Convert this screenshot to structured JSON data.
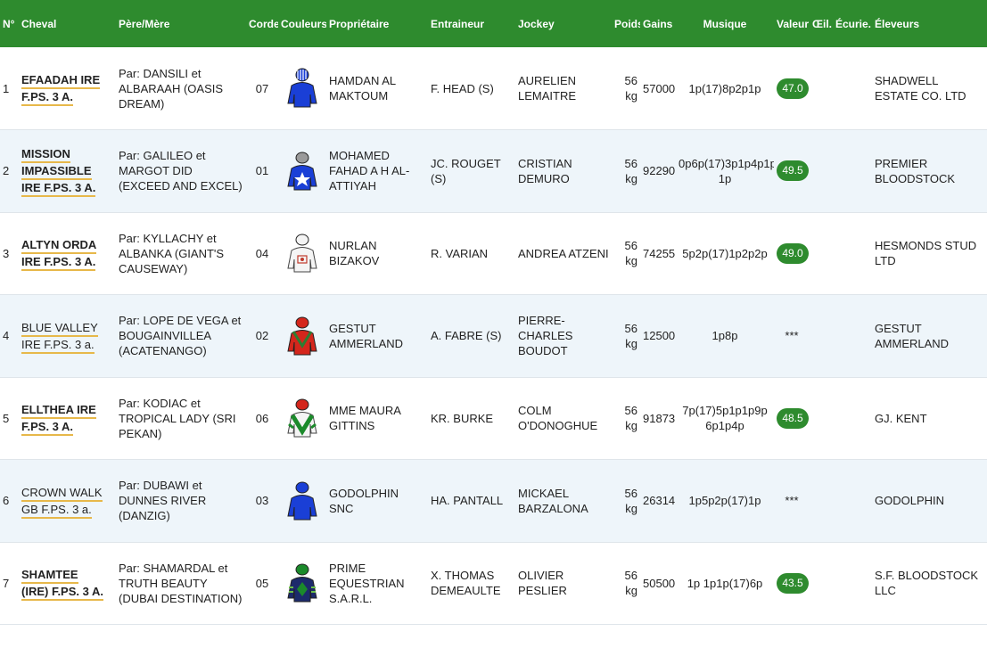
{
  "headers": {
    "num": "N°",
    "horse": "Cheval",
    "parents": "Père/Mère",
    "draw": "Corde",
    "colors": "Couleurs",
    "owner": "Propriétaire",
    "trainer": "Entraineur",
    "jockey": "Jockey",
    "weight": "Poids",
    "earnings": "Gains",
    "music": "Musique",
    "value": "Valeur",
    "eye": "Œil.",
    "stable": "Écurie.",
    "breeders": "Éleveurs"
  },
  "rows": [
    {
      "num": "1",
      "horse_line1": "EFAADAH IRE",
      "horse_line2": "F.PS. 3 A.",
      "horse_bold": true,
      "parents": "Par: DANSILI et ALBARAAH (OASIS DREAM)",
      "draw": "07",
      "silk_icon": "jockey-silk-blue-cap-icon",
      "owner": "HAMDAN AL MAKTOUM",
      "trainer": "F. HEAD (S)",
      "jockey": "AURELIEN LEMAITRE",
      "weight": "56 kg",
      "earnings": "57000",
      "music": "1p(17)8p2p1p",
      "value": "47.0",
      "breeder": "SHADWELL ESTATE CO. LTD"
    },
    {
      "num": "2",
      "horse_line1": "MISSION IMPASSIBLE",
      "horse_line2": "IRE F.PS. 3 A.",
      "horse_bold": true,
      "parents": "Par: GALILEO et MARGOT DID (EXCEED AND EXCEL)",
      "draw": "01",
      "silk_icon": "jockey-silk-blue-star-icon",
      "owner": "MOHAMED FAHAD A H AL-ATTIYAH",
      "trainer": "JC. ROUGET (S)",
      "jockey": "CRISTIAN DEMURO",
      "weight": "56 kg",
      "earnings": "92290",
      "music": "0p6p(17)3p1p4p1p 1p",
      "value": "49.5",
      "breeder": "PREMIER BLOODSTOCK"
    },
    {
      "num": "3",
      "horse_line1": "ALTYN ORDA",
      "horse_line2": "IRE F.PS. 3 A.",
      "horse_bold": true,
      "parents": "Par: KYLLACHY et ALBANKA (GIANT'S CAUSEWAY)",
      "draw": "04",
      "silk_icon": "jockey-silk-white-icon",
      "owner": "NURLAN BIZAKOV",
      "trainer": "R. VARIAN",
      "jockey": "ANDREA ATZENI",
      "weight": "56 kg",
      "earnings": "74255",
      "music": "5p2p(17)1p2p2p",
      "value": "49.0",
      "breeder": "HESMONDS STUD LTD"
    },
    {
      "num": "4",
      "horse_line1": "BLUE VALLEY",
      "horse_line2": "IRE F.PS. 3 a.",
      "horse_bold": false,
      "parents": "Par: LOPE DE VEGA et BOUGAINVILLEA (ACATENANGO)",
      "draw": "02",
      "silk_icon": "jockey-silk-red-green-icon",
      "owner": "GESTUT AMMERLAND",
      "trainer": "A. FABRE (S)",
      "jockey": "PIERRE-CHARLES BOUDOT",
      "weight": "56 kg",
      "earnings": "12500",
      "music": "1p8p",
      "value": "***",
      "breeder": "GESTUT AMMERLAND"
    },
    {
      "num": "5",
      "horse_line1": "ELLTHEA IRE",
      "horse_line2": "F.PS. 3 A.",
      "horse_bold": true,
      "parents": "Par: KODIAC et TROPICAL LADY (SRI PEKAN)",
      "draw": "06",
      "silk_icon": "jockey-silk-white-green-chevron-icon",
      "owner": "MME MAURA GITTINS",
      "trainer": "KR. BURKE",
      "jockey": "COLM O'DONOGHUE",
      "weight": "56 kg",
      "earnings": "91873",
      "music": "7p(17)5p1p1p9p 6p1p4p",
      "value": "48.5",
      "breeder": "GJ. KENT"
    },
    {
      "num": "6",
      "horse_line1": "CROWN WALK",
      "horse_line2": "GB F.PS. 3 a.",
      "horse_bold": false,
      "parents": "Par: DUBAWI et DUNNES RIVER (DANZIG)",
      "draw": "03",
      "silk_icon": "jockey-silk-blue-icon",
      "owner": "GODOLPHIN SNC",
      "trainer": "HA. PANTALL",
      "jockey": "MICKAEL BARZALONA",
      "weight": "56 kg",
      "earnings": "26314",
      "music": "1p5p2p(17)1p",
      "value": "***",
      "breeder": "GODOLPHIN"
    },
    {
      "num": "7",
      "horse_line1": "SHAMTEE",
      "horse_line2": "(IRE) F.PS. 3 A.",
      "horse_bold": true,
      "parents": "Par: SHAMARDAL et TRUTH BEAUTY (DUBAI DESTINATION)",
      "draw": "05",
      "silk_icon": "jockey-silk-navy-green-icon",
      "owner": "PRIME EQUESTRIAN S.A.R.L.",
      "trainer": "X. THOMAS DEMEAULTE",
      "jockey": "OLIVIER PESLIER",
      "weight": "56 kg",
      "earnings": "50500",
      "music": "1p 1p1p(17)6p",
      "value": "43.5",
      "breeder": "S.F. BLOODSTOCK LLC"
    }
  ]
}
